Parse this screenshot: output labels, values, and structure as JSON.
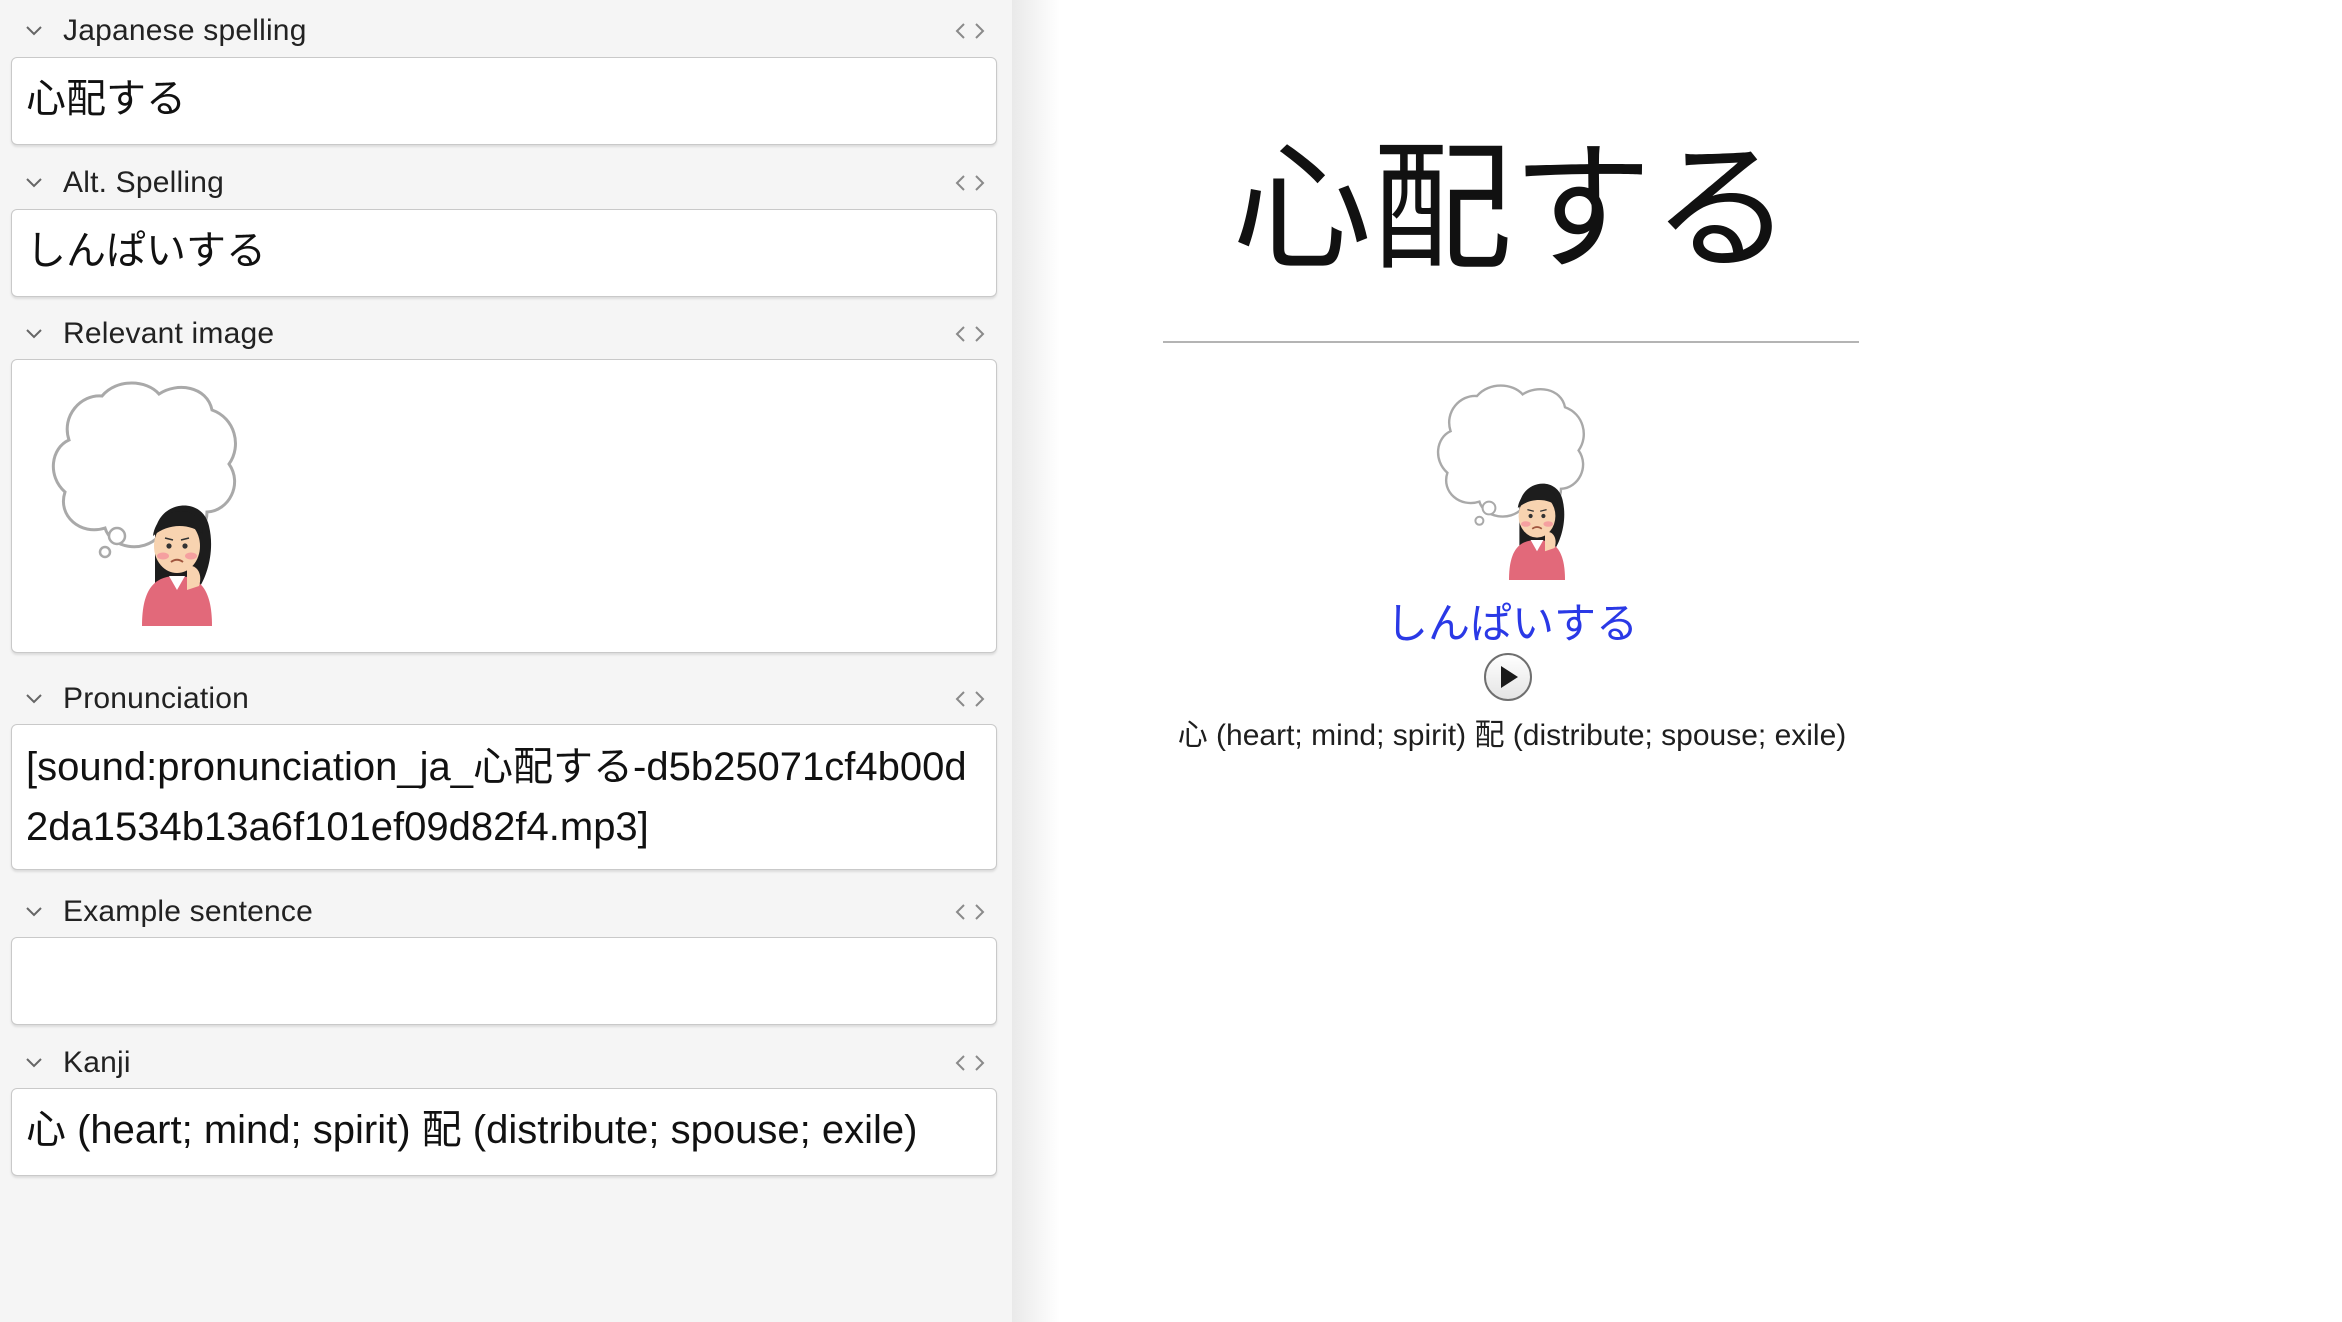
{
  "editor": {
    "fields": [
      {
        "label": "Japanese spelling",
        "value": "心配する"
      },
      {
        "label": "Alt. Spelling",
        "value": "しんぱいする"
      },
      {
        "label": "Relevant image",
        "value": ""
      },
      {
        "label": "Pronunciation",
        "value": "[sound:pronunciation_ja_心配する-d5b25071cf4b00d2da1534b13a6f101ef09d82f4.mp3]"
      },
      {
        "label": "Example sentence",
        "value": ""
      },
      {
        "label": "Kanji",
        "value": "心 (heart; mind; spirit) 配 (distribute; spouse; exile)"
      }
    ],
    "icons": {
      "collapse": "chevron-down-icon",
      "html_editor": "code-brackets-icon"
    }
  },
  "preview": {
    "word": "心配する",
    "reading": "しんぱいする",
    "kanji_info": "心 (heart; mind; spirit) 配 (distribute; spouse; exile)",
    "play_icon": "play-icon"
  },
  "colors": {
    "reading_link": "#2a39e6",
    "editor_bg": "#f5f5f5",
    "preview_bg": "#ffffff"
  }
}
